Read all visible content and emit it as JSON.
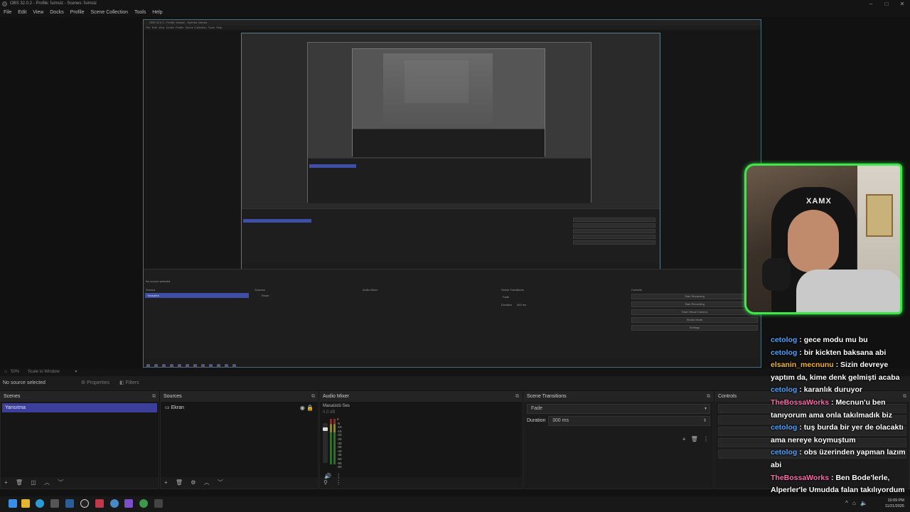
{
  "window": {
    "title": "OBS 32.0.2 - Profile: İsimsiz - Scenes: İsimsiz",
    "menu": [
      "File",
      "Edit",
      "View",
      "Docks",
      "Profile",
      "Scene Collection",
      "Tools",
      "Help"
    ],
    "minimize_glyph": "–",
    "maximize_glyph": "□",
    "close_glyph": "✕"
  },
  "preview": {
    "zoom": "50%",
    "scale_mode": "Scale to Window",
    "no_source": "No source selected",
    "properties_label": "Properties",
    "filters_label": "Filters"
  },
  "nested": {
    "title": "OBS 32.0.2 - Profile: İsimsiz - Scenes: İsimsiz",
    "menu": [
      "File",
      "Edit",
      "View",
      "Docks",
      "Profile",
      "Scene Collection",
      "Tools",
      "Help"
    ],
    "no_source": "No source selected",
    "scenes_label": "Scenes",
    "sources_label": "Sources",
    "mixer_label": "Audio Mixer",
    "transitions_label": "Scene Transitions",
    "controls_label": "Controls",
    "scene_item": "Yansıtma",
    "source_item": "Ekran",
    "transition_value": "Fade",
    "duration_label": "Duration",
    "duration_value": "300 ms",
    "buttons": [
      "Start Streaming",
      "Start Recording",
      "Start Virtual Camera",
      "Studio Mode",
      "Settings"
    ]
  },
  "webcam": {
    "chair_logo": "XAMX"
  },
  "chat": [
    {
      "user": "cetolog",
      "color": "#4aa3ff",
      "text": "gece modu mu bu"
    },
    {
      "user": "cetolog",
      "color": "#4aa3ff",
      "text": "bir kickten baksana abi"
    },
    {
      "user": "elsanin_mecnunu",
      "color": "#f0b23a",
      "text": "Sizin devreye yaptım da, kime denk gelmişti acaba"
    },
    {
      "user": "cetolog",
      "color": "#4aa3ff",
      "text": "karanlık duruyor"
    },
    {
      "user": "TheBossaWorks",
      "color": "#ff6aa8",
      "text": "Mecnun'u ben tanıyorum ama onla takılmadık biz"
    },
    {
      "user": "cetolog",
      "color": "#4aa3ff",
      "text": "tuş burda bir yer de olacaktı ama nereye koymuştum"
    },
    {
      "user": "cetolog",
      "color": "#4aa3ff",
      "text": "obs üzerinden yapman lazım abi"
    },
    {
      "user": "TheBossaWorks",
      "color": "#ff6aa8",
      "text": "Ben Bode'lerle, Alperler'le Umudda falan takılıyordum çok"
    }
  ],
  "docks": {
    "scenes": {
      "title": "Scenes",
      "items": [
        "Yansıtma"
      ]
    },
    "sources": {
      "title": "Sources",
      "items": [
        "Ekran"
      ]
    },
    "mixer": {
      "title": "Audio Mixer",
      "channel": "Masaüstü Ses",
      "level": "0.0 dB",
      "scale": [
        "0",
        "-5",
        "-10",
        "-15",
        "-20",
        "-25",
        "-30",
        "-35",
        "-40",
        "-45",
        "-50",
        "-55",
        "-60"
      ]
    },
    "transitions": {
      "title": "Scene Transitions",
      "value": "Fade",
      "duration_label": "Duration",
      "duration_value": "300 ms"
    },
    "controls": {
      "title": "Controls"
    }
  },
  "taskbar": {
    "time": "10:09 PM",
    "date": "11/21/2025",
    "icons": [
      "windows-icon",
      "explorer-icon",
      "edge-icon",
      "chrome-icon",
      "store-icon",
      "steam-icon",
      "obs-icon",
      "app-icon",
      "app-icon-2",
      "discord-icon",
      "app-icon-3",
      "xbox-icon",
      "terminal-icon"
    ]
  }
}
